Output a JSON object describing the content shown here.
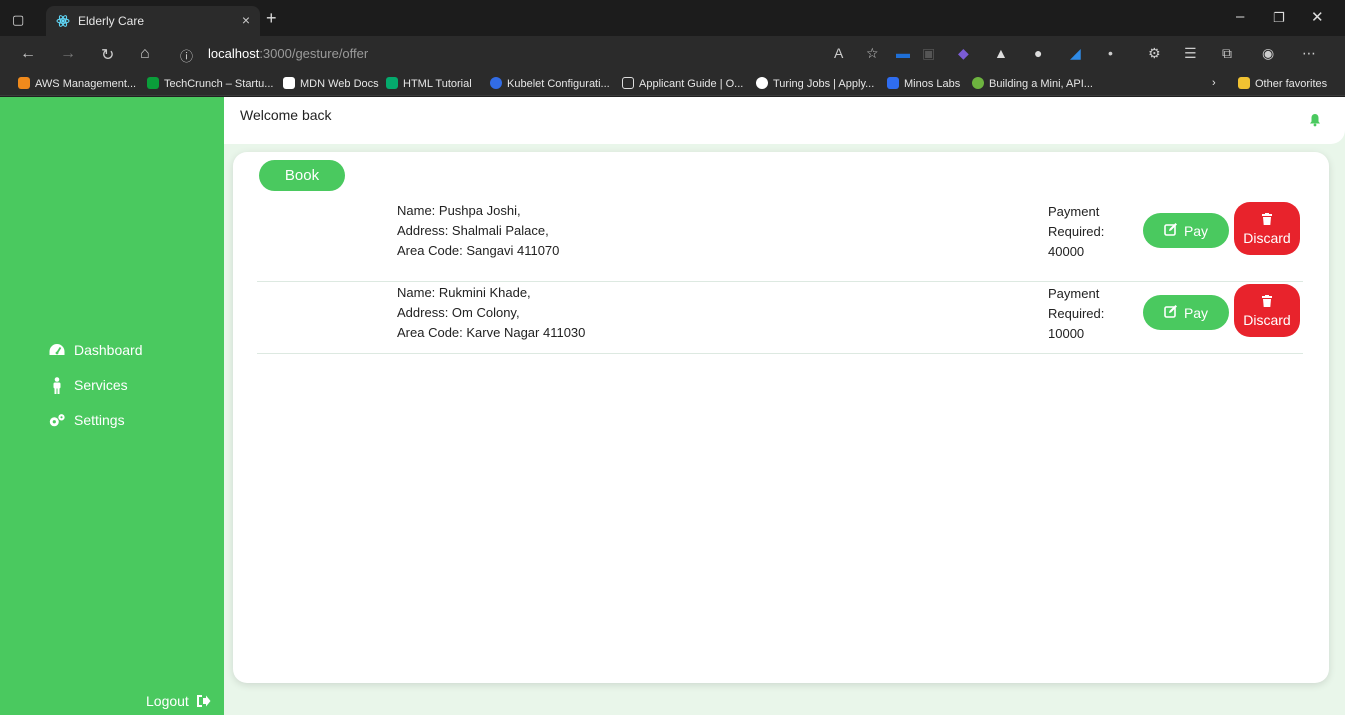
{
  "browser": {
    "tab_title": "Elderly Care",
    "url_host": "localhost",
    "url_path": ":3000/gesture/offer",
    "bookmarks": [
      "AWS Management...",
      "TechCrunch – Startu...",
      "MDN Web Docs",
      "HTML Tutorial",
      "Kubelet Configurati...",
      "Applicant Guide | O...",
      "Turing Jobs | Apply...",
      "Minos Labs",
      "Building a Mini, API..."
    ],
    "other_favorites": "Other favorites"
  },
  "sidebar": {
    "items": [
      {
        "label": "Dashboard",
        "icon": "dashboard-icon"
      },
      {
        "label": "Services",
        "icon": "person-icon"
      },
      {
        "label": "Settings",
        "icon": "gears-icon"
      }
    ],
    "logout": "Logout"
  },
  "header": {
    "welcome": "Welcome back"
  },
  "content": {
    "book_label": "Book",
    "offers": [
      {
        "name_line": "Name: Pushpa Joshi,",
        "address_line": "Address: Shalmali Palace,",
        "area_line": "Area Code: Sangavi 411070",
        "payment_line1": "Payment",
        "payment_line2": "Required:",
        "payment_amount": "40000",
        "pay_label": "Pay",
        "discard_label": "Discard"
      },
      {
        "name_line": "Name: Rukmini Khade,",
        "address_line": "Address: Om Colony,",
        "area_line": "Area Code: Karve Nagar 411030",
        "payment_line1": "Payment",
        "payment_line2": "Required:",
        "payment_amount": "10000",
        "pay_label": "Pay",
        "discard_label": "Discard"
      }
    ]
  },
  "colors": {
    "brand_green": "#4ac95f",
    "danger_red": "#e8232c"
  }
}
